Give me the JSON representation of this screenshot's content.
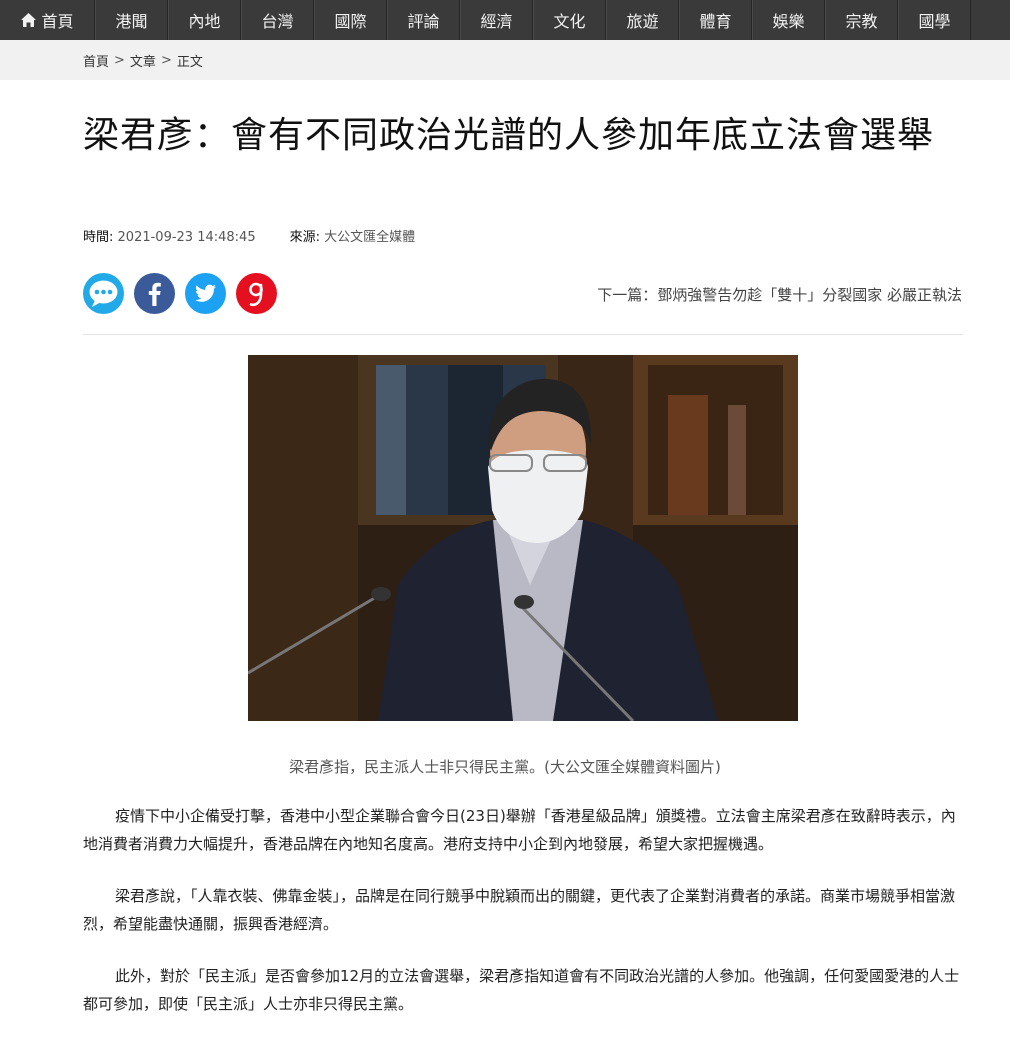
{
  "nav": {
    "items": [
      "首頁",
      "港聞",
      "內地",
      "台灣",
      "國際",
      "評論",
      "經濟",
      "文化",
      "旅遊",
      "體育",
      "娛樂",
      "宗教",
      "國學"
    ]
  },
  "breadcrumb": {
    "items": [
      "首頁",
      "文章",
      "正文"
    ],
    "separator": ">"
  },
  "article": {
    "title": "梁君彥：會有不同政治光譜的人參加年底立法會選舉",
    "time_label": "時間:",
    "time_value": "2021-09-23 14:48:45",
    "source_label": "來源:",
    "source_value": "大公文匯全媒體",
    "next_article": "下一篇：鄧炳強警告勿趁「雙十」分裂國家 必嚴正執法",
    "photo_caption": "梁君彥指，民主派人士非只得民主黨。(大公文匯全媒體資料圖片)",
    "paragraphs": [
      "疫情下中小企備受打擊，香港中小型企業聯合會今日(23日)舉辦「香港星級品牌」頒獎禮。立法會主席梁君彥在致辭時表示，內地消費者消費力大幅提升，香港品牌在內地知名度高。港府支持中小企到內地發展，希望大家把握機遇。",
      "梁君彥說，「人靠衣裝、佛靠金裝」，品牌是在同行競爭中脫穎而出的關鍵，更代表了企業對消費者的承諾。商業市場競爭相當激烈，希望能盡快通關，振興香港經濟。",
      "此外，對於「民主派」是否會參加12月的立法會選舉，梁君彥指知道會有不同政治光譜的人參加。他強調，任何愛國愛港的人士都可參加，即使「民主派」人士亦非只得民主黨。"
    ]
  },
  "share": {
    "icons": [
      "chat-bubble-icon",
      "facebook-icon",
      "twitter-icon",
      "google-plus-icon"
    ]
  },
  "colors": {
    "nav_bg": "#3a3a3a",
    "breadcrumb_bg": "#f1f1f1",
    "chat": "#22a9e8",
    "facebook": "#3b5a9a",
    "twitter": "#1da1f2",
    "google_plus": "#e5101f"
  }
}
